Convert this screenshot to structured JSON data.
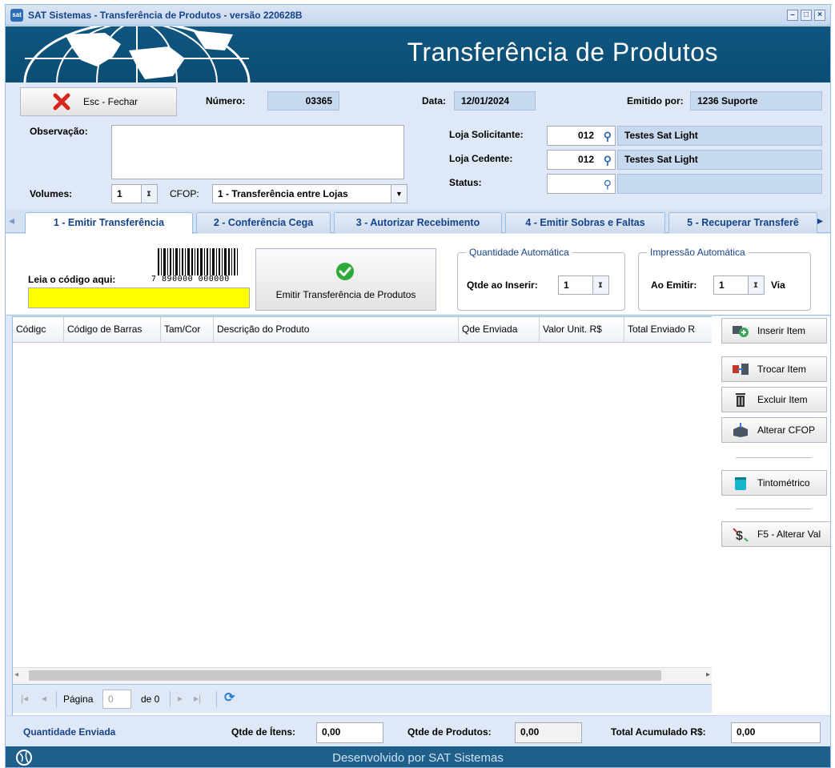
{
  "window": {
    "title": "SAT Sistemas - Transferência de Produtos - versão 220628B",
    "logo_text": "sat"
  },
  "banner": {
    "title": "Transferência de Produtos"
  },
  "header": {
    "close_button": "Esc - Fechar",
    "numero_label": "Número:",
    "numero_value": "03365",
    "data_label": "Data:",
    "data_value": "12/01/2024",
    "emitido_label": "Emitido por:",
    "emitido_value": "1236 Suporte",
    "observacao_label": "Observação:",
    "observacao_value": "",
    "volumes_label": "Volumes:",
    "volumes_value": "1",
    "cfop_label": "CFOP:",
    "cfop_value": "1 - Transferência entre Lojas",
    "loja_solicitante_label": "Loja Solicitante:",
    "loja_solicitante_code": "012",
    "loja_solicitante_name": "Testes Sat Light",
    "loja_cedente_label": "Loja Cedente:",
    "loja_cedente_code": "012",
    "loja_cedente_name": "Testes Sat Light",
    "status_label": "Status:",
    "status_code": "",
    "status_name": ""
  },
  "tabs": [
    {
      "label": "1 - Emitir Transferência",
      "active": true
    },
    {
      "label": "2 - Conferência Cega",
      "active": false
    },
    {
      "label": "3 - Autorizar Recebimento",
      "active": false
    },
    {
      "label": "4 - Emitir Sobras e Faltas",
      "active": false
    },
    {
      "label": "5 - Recuperar Transferê",
      "active": false
    }
  ],
  "emit_panel": {
    "barcode_label": "Leia o código aqui:",
    "barcode_digits": "7 890000 000000",
    "barcode_value": "",
    "emit_button": "Emitir Transferência de Produtos",
    "qtd_auto_legend": "Quantidade Automática",
    "qtd_inserir_label": "Qtde ao Inserir:",
    "qtd_inserir_value": "1",
    "impressao_legend": "Impressão Automática",
    "ao_emitir_label": "Ao Emitir:",
    "ao_emitir_value": "1",
    "via_label": "Via"
  },
  "grid": {
    "columns": [
      "Códigc",
      "Código de Barras",
      "Tam/Cor",
      "Descrição do Produto",
      "Qde Enviada",
      "Valor Unit. R$",
      "Total Enviado R"
    ],
    "rows": []
  },
  "pager": {
    "page_label": "Página",
    "page_value": "0",
    "of_label": "de 0"
  },
  "side_buttons": {
    "inserir": "Inserir Item",
    "trocar": "Trocar Item",
    "excluir": "Excluir Item",
    "alterar_cfop": "Alterar CFOP",
    "tintometrico": "Tintométrico",
    "alterar_val": "F5 - Alterar Val"
  },
  "footer": {
    "section_label": "Quantidade Enviada",
    "qtde_itens_label": "Qtde de Ítens:",
    "qtde_itens_value": "0,00",
    "qtde_produtos_label": "Qtde de Produtos:",
    "qtde_produtos_value": "0,00",
    "total_label": "Total Acumulado R$:",
    "total_value": "0,00"
  },
  "bottombar": {
    "text": "Desenvolvido por SAT Sistemas"
  },
  "colors": {
    "banner": "#0f5680",
    "accent": "#15428b",
    "barcode_input": "#ffff00",
    "readonly": "#c7d9ef"
  }
}
